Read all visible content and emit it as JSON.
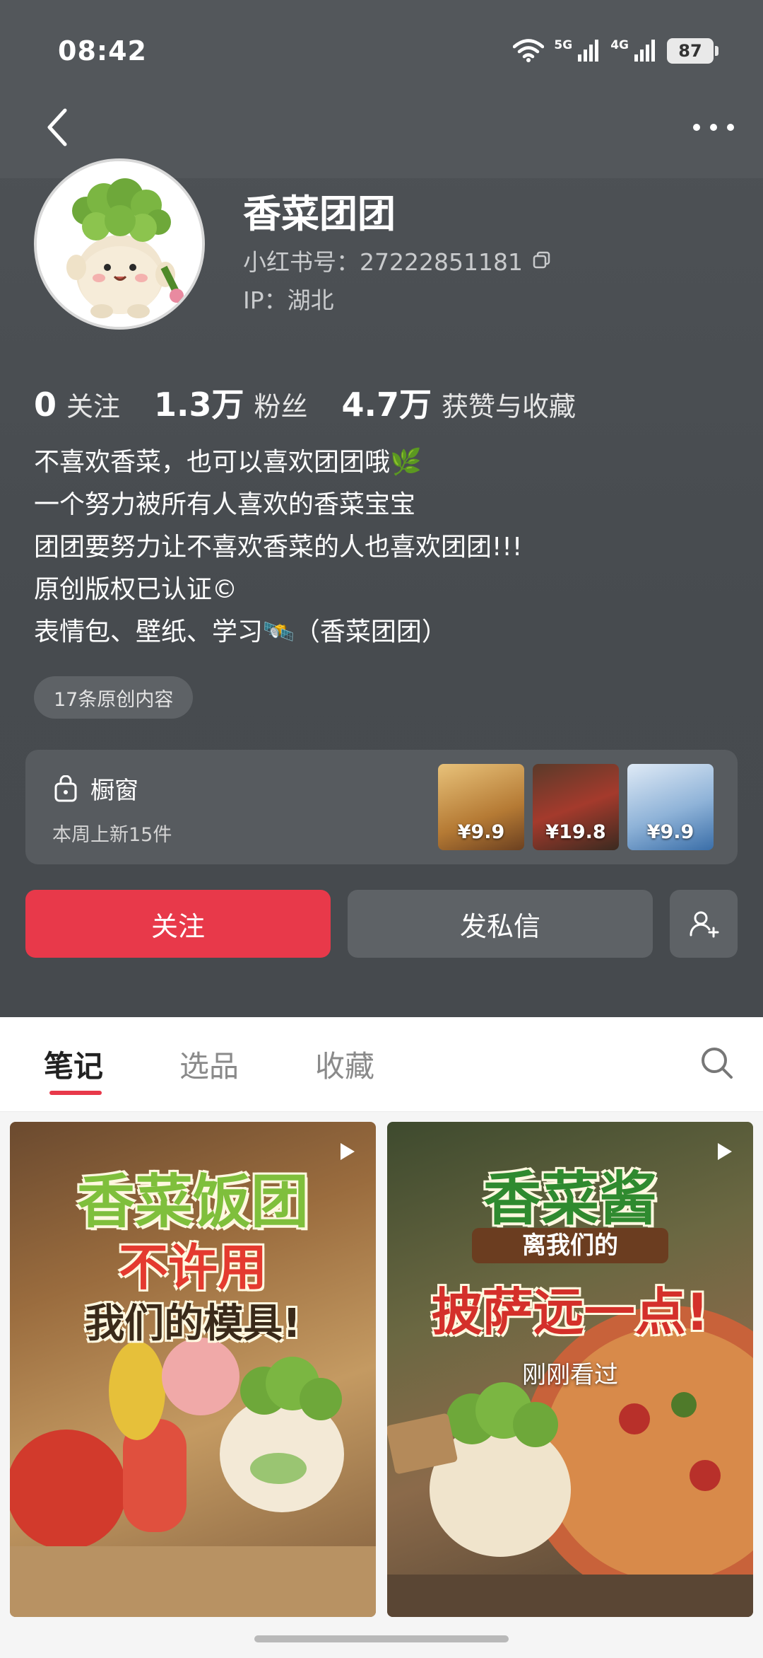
{
  "status_bar": {
    "time": "08:42",
    "signal_1": "5G",
    "signal_2": "4G",
    "battery": "87"
  },
  "profile": {
    "nickname": "香菜团团",
    "red_id": "小红书号：27222851181",
    "ip": "IP：湖北"
  },
  "stats": {
    "following_num": "0",
    "following_label": "关注",
    "fans_num": "1.3万",
    "fans_label": "粉丝",
    "likes_num": "4.7万",
    "likes_label": "获赞与收藏"
  },
  "bio": [
    "不喜欢香菜，也可以喜欢团团哦🌿",
    "一个努力被所有人喜欢的香菜宝宝",
    "团团要努力让不喜欢香菜的人也喜欢团团!!!",
    "原创版权已认证©",
    "表情包、壁纸、学习🛰️（香菜团团）"
  ],
  "tag": "17条原创内容",
  "shop": {
    "title": "橱窗",
    "subtitle": "本周上新15件",
    "items": [
      {
        "price": "¥9.9",
        "color": "#c89a4a"
      },
      {
        "price": "¥19.8",
        "color": "#8a3a2a"
      },
      {
        "price": "¥9.9",
        "color": "#9ab8d8"
      }
    ]
  },
  "actions": {
    "follow": "关注",
    "message": "发私信"
  },
  "tabs": [
    {
      "label": "笔记",
      "active": true
    },
    {
      "label": "选品",
      "active": false
    },
    {
      "label": "收藏",
      "active": false
    }
  ],
  "notes": [
    {
      "line1": "香菜饭团",
      "line2": "不许用",
      "line3": "我们的模具!"
    },
    {
      "line1": "香菜酱",
      "line2": "离我们的",
      "line3": "披萨远一点!",
      "overlay": "刚刚看过"
    }
  ],
  "colors": {
    "accent": "#e8394a",
    "header_bg": "#4b4f53"
  }
}
